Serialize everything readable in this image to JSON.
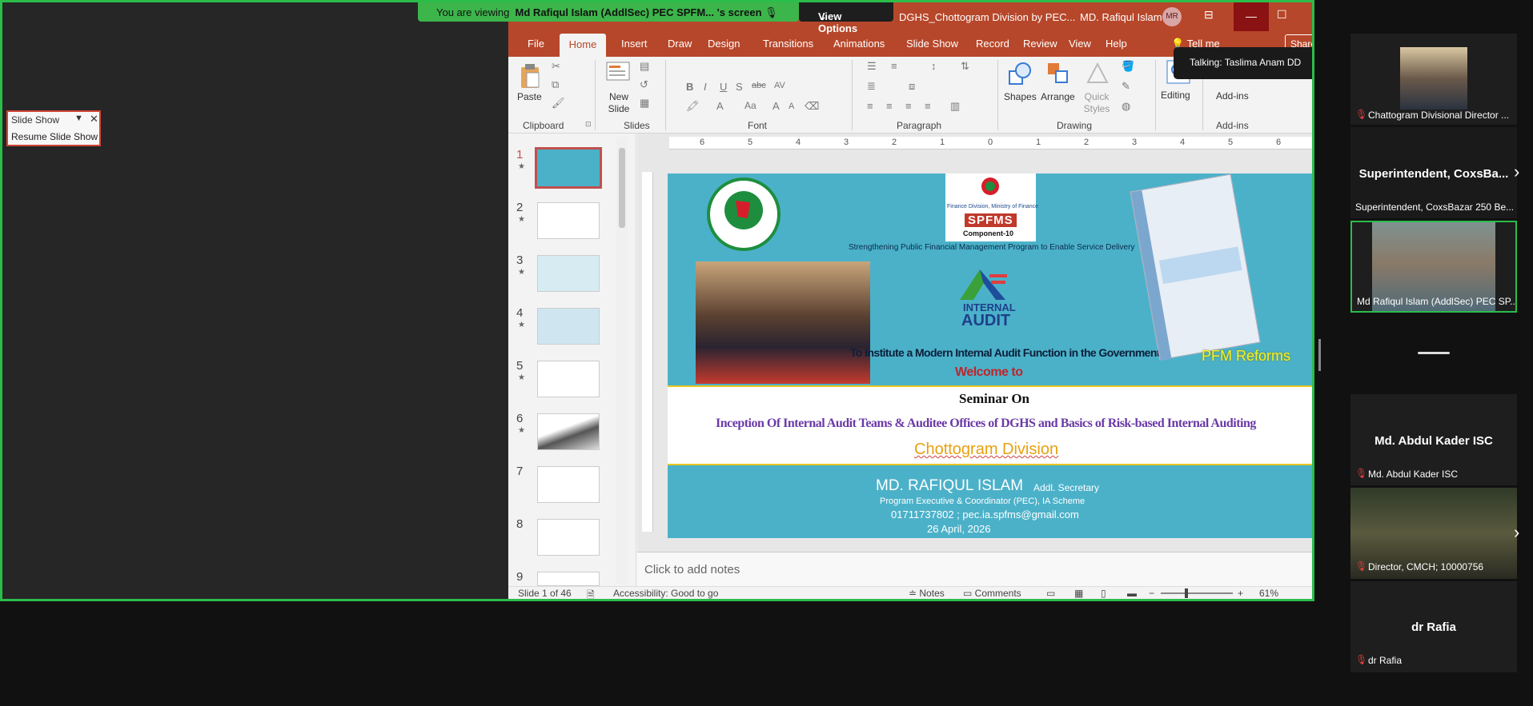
{
  "banner": {
    "prefix": "You are viewing",
    "name": "Md Rafiqul Islam (AddlSec) PEC SPFM...",
    "suffix": "'s screen",
    "view_options": "View Options"
  },
  "slideshow_float": {
    "title": "Slide Show",
    "resume": "Resume Slide Show"
  },
  "ppt": {
    "title": "DGHS_Chottogram Division by PEC...",
    "user": "MD. Rafiqul Islam",
    "avatar": "MR",
    "menu": [
      "File",
      "Home",
      "Insert",
      "Draw",
      "Design",
      "Transitions",
      "Animations",
      "Slide Show",
      "Record",
      "Review",
      "View",
      "Help",
      "Tell me"
    ],
    "share": "Share",
    "ribbon": {
      "paste": "Paste",
      "new_slide": "New Slide",
      "shapes": "Shapes",
      "arrange": "Arrange",
      "quick_styles": "Quick Styles",
      "editing": "Editing",
      "addins": "Add-ins",
      "groups": [
        "Clipboard",
        "Slides",
        "Font",
        "Paragraph",
        "Drawing",
        "Add-ins"
      ]
    },
    "talking": "Talking: Taslima Anam DD",
    "thumb_numbers": [
      "1",
      "2",
      "3",
      "4",
      "5",
      "6",
      "7",
      "8",
      "9"
    ],
    "ruler_numbers": [
      "6",
      "5",
      "4",
      "3",
      "2",
      "1",
      "0",
      "1",
      "2",
      "3",
      "4",
      "5",
      "6"
    ],
    "notes_placeholder": "Click to add notes",
    "status": {
      "slide": "Slide 1 of 46",
      "accessibility": "Accessibility: Good to go",
      "notes": "Notes",
      "comments": "Comments",
      "zoom": "61%"
    }
  },
  "slide": {
    "fd_line1": "Finance Division, Ministry of Finance",
    "spfms": "SPFMS",
    "component": "Component-10",
    "strengthening": "Strengthening Public Financial Management Program to Enable Service Delivery",
    "internal": "INTERNAL",
    "audit": "AUDIT",
    "institute": "To Institute a Modern Internal Audit Function in the Government",
    "pfm": "PFM Reforms",
    "welcome": "Welcome to",
    "seminar": "Seminar On",
    "inception": "Inception Of Internal Audit Teams & Auditee Offices of DGHS and Basics of Risk-based Internal Auditing",
    "division": "Chottogram Division",
    "presenter": "MD. RAFIQUL ISLAM",
    "presenter_title": "Addl. Secretary",
    "role": "Program Executive & Coordinator (PEC), IA Scheme",
    "contact": "01711737802 ; pec.ia.spfms@gmail.com",
    "date": "26 April, 2026"
  },
  "gallery": {
    "t1_name": "Chattogram Divisional Director ...",
    "t2_big": "Superintendent, CoxsBa...",
    "t2_name": "Superintendent, CoxsBazar 250 Be...",
    "t3_name": "Md Rafiqul Islam (AddlSec) PEC SP...",
    "t4_big": "Md. Abdul Kader ISC",
    "t4_name": "Md. Abdul Kader ISC",
    "t5_name": "Director, CMCH; 10000756",
    "t6_big": "dr Rafia",
    "t6_name": "dr Rafia"
  },
  "colors": {
    "ppt_red": "#b7472a",
    "zoom_green": "#2bbd4a",
    "slide_teal": "#4bb1c9"
  }
}
